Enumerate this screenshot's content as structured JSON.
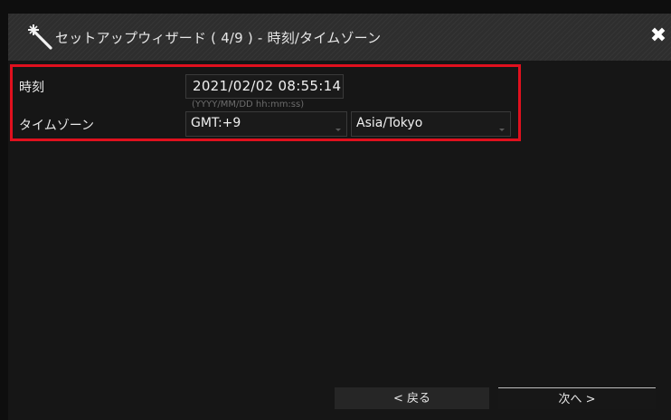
{
  "window": {
    "title": "セットアップウィザード ( 4/9 ) - 時刻/タイムゾーン",
    "title_icon": "magic-wand-icon",
    "close_icon": "close-icon"
  },
  "form": {
    "time_label": "時刻",
    "datetime_value": "2021/02/02 08:55:14",
    "datetime_format_hint": "(YYYY/MM/DD hh:mm:ss)",
    "timezone_label": "タイムゾーン",
    "gmt_offset_selected": "GMT:+9",
    "timezone_selected": "Asia/Tokyo"
  },
  "buttons": {
    "back_label": "< 戻る",
    "next_label": "次へ >"
  },
  "colors": {
    "highlight_border": "#e0101e",
    "window_bg": "#161616",
    "titlebar_bg": "#2e2e2e"
  }
}
